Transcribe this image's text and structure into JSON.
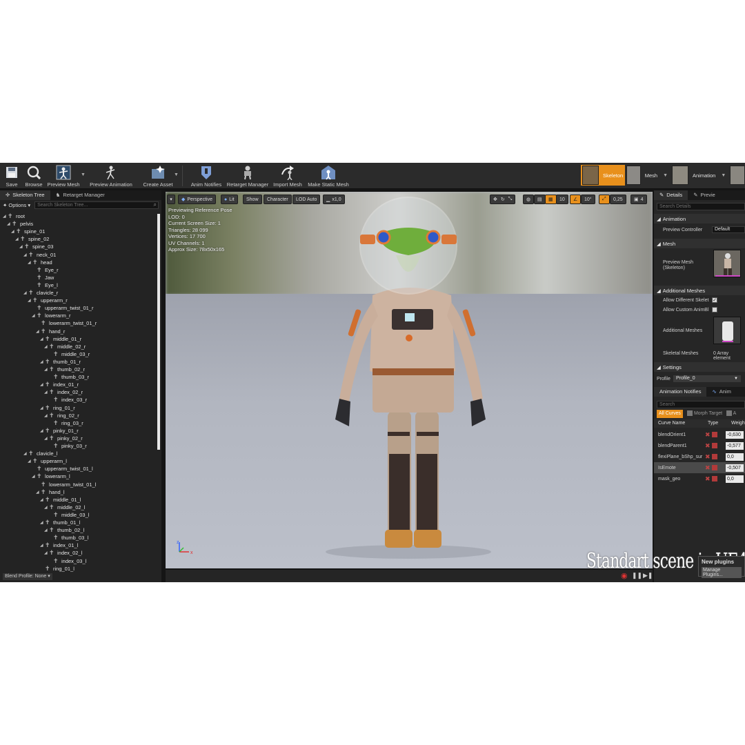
{
  "toolbar": {
    "buttons": [
      {
        "label": "Save",
        "icon": "save-icon"
      },
      {
        "label": "Browse",
        "icon": "browse-icon"
      },
      {
        "label": "Preview Mesh",
        "icon": "preview-mesh-icon"
      },
      {
        "label": "Preview Animation",
        "icon": "preview-animation-icon"
      },
      {
        "label": "Create Asset",
        "icon": "create-asset-icon"
      },
      {
        "label": "Anim Notifies",
        "icon": "anim-notifies-icon"
      },
      {
        "label": "Retarget Manager",
        "icon": "retarget-manager-icon"
      },
      {
        "label": "Import Mesh",
        "icon": "import-mesh-icon"
      },
      {
        "label": "Make Static Mesh",
        "icon": "make-static-mesh-icon"
      }
    ],
    "modes": [
      {
        "label": "Skeleton",
        "active": true
      },
      {
        "label": "Mesh",
        "active": false
      },
      {
        "label": "Animation",
        "active": false
      }
    ],
    "accent": "#e8901c"
  },
  "left_panel": {
    "tabs": [
      "Skeleton Tree",
      "Retarget Manager"
    ],
    "options_label": "Options",
    "search_placeholder": "Search Skeleton Tree...",
    "bones": [
      {
        "name": "root",
        "depth": 0
      },
      {
        "name": "pelvis",
        "depth": 1
      },
      {
        "name": "spine_01",
        "depth": 2
      },
      {
        "name": "spine_02",
        "depth": 3
      },
      {
        "name": "spine_03",
        "depth": 4
      },
      {
        "name": "neck_01",
        "depth": 5
      },
      {
        "name": "head",
        "depth": 6
      },
      {
        "name": "Eye_r",
        "depth": 7
      },
      {
        "name": "Jaw",
        "depth": 7
      },
      {
        "name": "Eye_l",
        "depth": 7
      },
      {
        "name": "clavicle_r",
        "depth": 5
      },
      {
        "name": "upperarm_r",
        "depth": 6
      },
      {
        "name": "upperarm_twist_01_r",
        "depth": 7
      },
      {
        "name": "lowerarm_r",
        "depth": 7
      },
      {
        "name": "lowerarm_twist_01_r",
        "depth": 8
      },
      {
        "name": "hand_r",
        "depth": 8
      },
      {
        "name": "middle_01_r",
        "depth": 9
      },
      {
        "name": "middle_02_r",
        "depth": 10
      },
      {
        "name": "middle_03_r",
        "depth": 11
      },
      {
        "name": "thumb_01_r",
        "depth": 9
      },
      {
        "name": "thumb_02_r",
        "depth": 10
      },
      {
        "name": "thumb_03_r",
        "depth": 11
      },
      {
        "name": "index_01_r",
        "depth": 9
      },
      {
        "name": "index_02_r",
        "depth": 10
      },
      {
        "name": "index_03_r",
        "depth": 11
      },
      {
        "name": "ring_01_r",
        "depth": 9
      },
      {
        "name": "ring_02_r",
        "depth": 10
      },
      {
        "name": "ring_03_r",
        "depth": 11
      },
      {
        "name": "pinky_01_r",
        "depth": 9
      },
      {
        "name": "pinky_02_r",
        "depth": 10
      },
      {
        "name": "pinky_03_r",
        "depth": 11
      },
      {
        "name": "clavicle_l",
        "depth": 5
      },
      {
        "name": "upperarm_l",
        "depth": 6
      },
      {
        "name": "upperarm_twist_01_l",
        "depth": 7
      },
      {
        "name": "lowerarm_l",
        "depth": 7
      },
      {
        "name": "lowerarm_twist_01_l",
        "depth": 8
      },
      {
        "name": "hand_l",
        "depth": 8
      },
      {
        "name": "middle_01_l",
        "depth": 9
      },
      {
        "name": "middle_02_l",
        "depth": 10
      },
      {
        "name": "middle_03_l",
        "depth": 11
      },
      {
        "name": "thumb_01_l",
        "depth": 9
      },
      {
        "name": "thumb_02_l",
        "depth": 10
      },
      {
        "name": "thumb_03_l",
        "depth": 11
      },
      {
        "name": "index_01_l",
        "depth": 9
      },
      {
        "name": "index_02_l",
        "depth": 10
      },
      {
        "name": "index_03_l",
        "depth": 11
      },
      {
        "name": "ring_01_l",
        "depth": 9
      }
    ],
    "blend_profile": "Blend Profile: None"
  },
  "viewport": {
    "perspective": "Perspective",
    "lit": "Lit",
    "show": "Show",
    "character": "Character",
    "lod": "LOD Auto",
    "speed": "x1,0",
    "grid_snap": "10",
    "rot_snap": "10°",
    "scale_snap": "0,25",
    "cam_speed": "4",
    "info": [
      "Previewing Reference Pose",
      "LOD: 0",
      "Current Screen Size: 1",
      "Triangles: 28 099",
      "Vertices: 17 700",
      "UV Channels: 1",
      "Approx Size: 78x50x165"
    ]
  },
  "right_panel": {
    "tabs": [
      "Details",
      "Previe"
    ],
    "search_placeholder": "Search Details",
    "animation_section": "Animation",
    "preview_controller_label": "Preview Controller",
    "preview_controller_value": "Default",
    "mesh_section": "Mesh",
    "preview_mesh_label": "Preview Mesh (Skeleton)",
    "additional_meshes_section": "Additional Meshes",
    "allow_different_label": "Allow Different Skelet",
    "allow_different_checked": true,
    "allow_custom_label": "Allow Custom AnimBl",
    "allow_custom_checked": false,
    "additional_meshes_label": "Additional Meshes",
    "skeletal_meshes_label": "Skeletal Meshes",
    "skeletal_meshes_value": "0 Array element",
    "settings_section": "Settings",
    "profile_label": "Profile",
    "profile_value": "Profile_0",
    "notify_tabs": [
      "Animation Notifies",
      "Anim"
    ],
    "curve_search": "Search",
    "filters": [
      "All Curves",
      "Morph Target",
      "A"
    ],
    "columns": [
      "Curve Name",
      "Type",
      "Weigh"
    ],
    "curves": [
      {
        "name": "blendOrient1",
        "value": "-0,630"
      },
      {
        "name": "blendParent1",
        "value": "-0,577"
      },
      {
        "name": "flexiPlane_bShp_sur",
        "value": "0,0"
      },
      {
        "name": "IsEmote",
        "value": "-0,507",
        "selected": true
      },
      {
        "name": "mask_geo",
        "value": "0,0"
      }
    ]
  },
  "overlay": {
    "watermark": "Standart scene in UE4",
    "notice_title": "New plugins",
    "notice_link": "Manage Plugins..."
  }
}
